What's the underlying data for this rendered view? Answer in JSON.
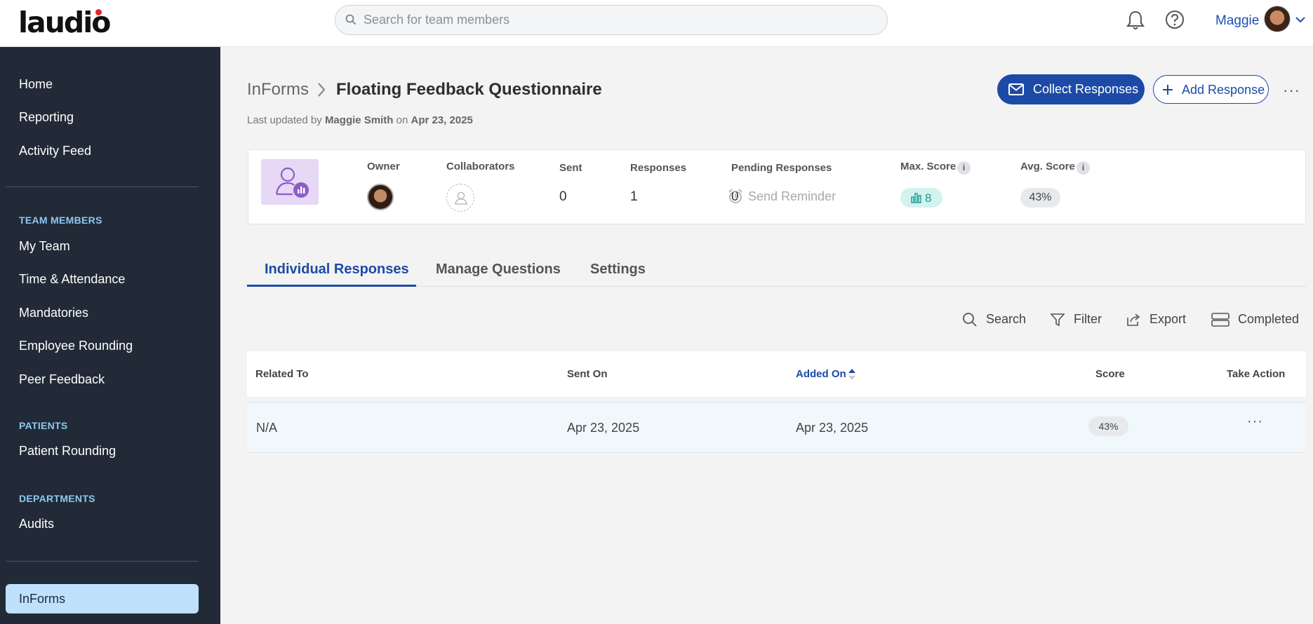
{
  "header": {
    "logo": "laudio",
    "search_placeholder": "Search for team members",
    "user_name": "Maggie"
  },
  "sidebar": {
    "items": [
      "Home",
      "Reporting",
      "Activity Feed"
    ],
    "team_members_heading": "TEAM MEMBERS",
    "team_items": [
      "My Team",
      "Time & Attendance",
      "Mandatories",
      "Employee Rounding",
      "Peer Feedback"
    ],
    "patients_heading": "PATIENTS",
    "patient_items": [
      "Patient Rounding"
    ],
    "departments_heading": "DEPARTMENTS",
    "department_items": [
      "Audits"
    ],
    "active_item": "InForms"
  },
  "page": {
    "breadcrumb_root": "InForms",
    "title": "Floating Feedback Questionnaire",
    "updated_prefix": "Last updated by",
    "updated_by": "Maggie Smith",
    "updated_on_word": "on",
    "updated_date": "Apr 23, 2025",
    "collect_label": "Collect Responses",
    "add_label": "Add Response",
    "more": "···"
  },
  "stats": {
    "owner_label": "Owner",
    "collaborators_label": "Collaborators",
    "sent_label": "Sent",
    "sent_value": "0",
    "responses_label": "Responses",
    "responses_value": "1",
    "pending_label": "Pending Responses",
    "pending_value": "0",
    "reminder_label": "Send Reminder",
    "max_label": "Max. Score",
    "max_value": "8",
    "avg_label": "Avg. Score",
    "avg_value": "43%",
    "info": "i"
  },
  "tabs": [
    "Individual Responses",
    "Manage Questions",
    "Settings"
  ],
  "toolbar": {
    "search": "Search",
    "filter": "Filter",
    "export": "Export",
    "view": "Completed"
  },
  "table": {
    "columns": [
      "Related To",
      "Sent On",
      "Added On",
      "Score",
      "Take Action"
    ],
    "rows": [
      {
        "related_to": "N/A",
        "sent_on": "Apr 23, 2025",
        "added_on": "Apr 23, 2025",
        "score": "43%",
        "action": "···"
      }
    ]
  },
  "colors": {
    "accent": "#1d4aa6",
    "sidebar": "#212a36",
    "active_nav": "#bfe1fb",
    "teal": "#169c94"
  }
}
